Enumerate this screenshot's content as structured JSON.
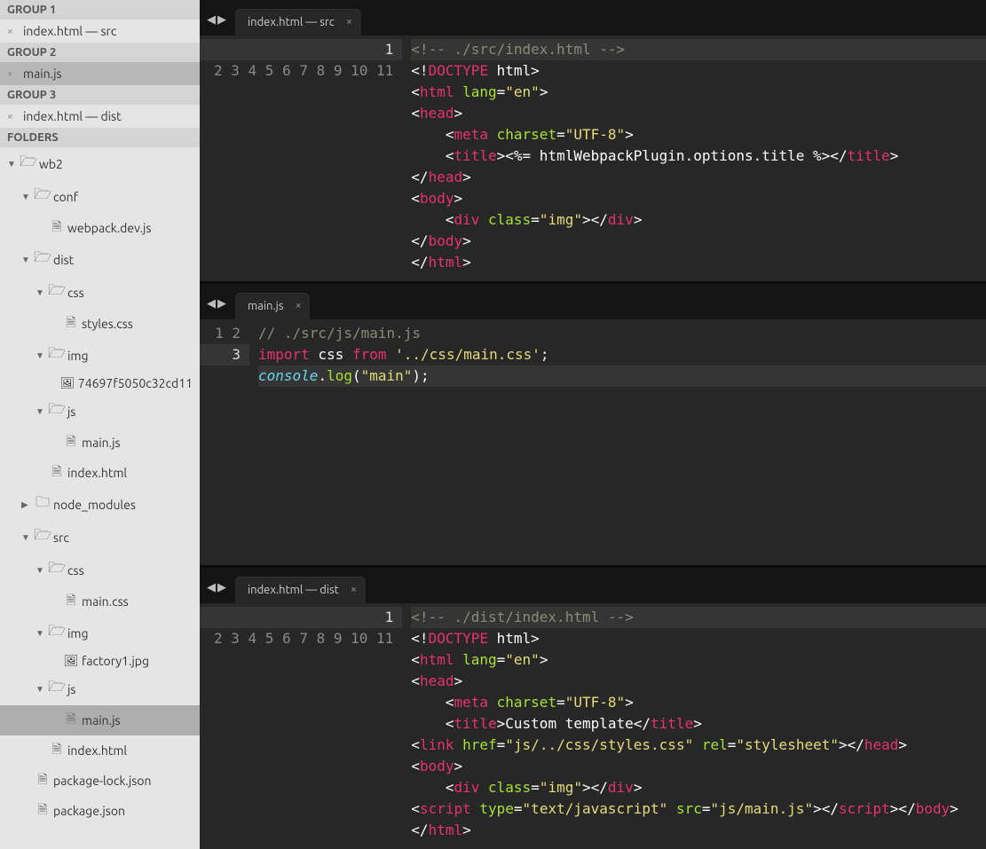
{
  "sidebar": {
    "groups": [
      {
        "title": "GROUP 1",
        "items": [
          {
            "label": "index.html — src",
            "active": false
          }
        ]
      },
      {
        "title": "GROUP 2",
        "items": [
          {
            "label": "main.js",
            "active": true
          }
        ]
      },
      {
        "title": "GROUP 3",
        "items": [
          {
            "label": "index.html — dist",
            "active": false
          }
        ]
      }
    ],
    "folders_label": "FOLDERS",
    "tree": [
      {
        "d": 0,
        "t": "folder-open",
        "a": "down",
        "l": "wb2"
      },
      {
        "d": 1,
        "t": "folder-open",
        "a": "down",
        "l": "conf"
      },
      {
        "d": 2,
        "t": "file",
        "l": "webpack.dev.js"
      },
      {
        "d": 1,
        "t": "folder-open",
        "a": "down",
        "l": "dist"
      },
      {
        "d": 2,
        "t": "folder-open",
        "a": "down",
        "l": "css"
      },
      {
        "d": 3,
        "t": "file",
        "l": "styles.css"
      },
      {
        "d": 2,
        "t": "folder-open",
        "a": "down",
        "l": "img"
      },
      {
        "d": 3,
        "t": "img",
        "l": "74697f5050c32cd11"
      },
      {
        "d": 2,
        "t": "folder-open",
        "a": "down",
        "l": "js"
      },
      {
        "d": 3,
        "t": "file",
        "l": "main.js"
      },
      {
        "d": 2,
        "t": "file",
        "l": "index.html"
      },
      {
        "d": 1,
        "t": "folder",
        "a": "right",
        "l": "node_modules"
      },
      {
        "d": 1,
        "t": "folder-open",
        "a": "down",
        "l": "src"
      },
      {
        "d": 2,
        "t": "folder-open",
        "a": "down",
        "l": "css"
      },
      {
        "d": 3,
        "t": "file",
        "l": "main.css"
      },
      {
        "d": 2,
        "t": "folder-open",
        "a": "down",
        "l": "img"
      },
      {
        "d": 3,
        "t": "img",
        "l": "factory1.jpg"
      },
      {
        "d": 2,
        "t": "folder-open",
        "a": "down",
        "l": "js"
      },
      {
        "d": 3,
        "t": "file",
        "l": "main.js",
        "sel": true
      },
      {
        "d": 2,
        "t": "file",
        "l": "index.html"
      },
      {
        "d": 1,
        "t": "file",
        "l": "package-lock.json"
      },
      {
        "d": 1,
        "t": "file",
        "l": "package.json"
      }
    ]
  },
  "panes": [
    {
      "tab": "index.html — src",
      "active_line": 1,
      "lines": [
        "<span class='cm'>&lt;!-- ./src/index.html --&gt;</span>",
        "<span class='pn'>&lt;!</span><span class='kw'>DOCTYPE</span><span class='pn'> html&gt;</span>",
        "<span class='pn'>&lt;</span><span class='kw'>html</span> <span class='tg'>lang</span><span class='pn'>=</span><span class='st'>\"en\"</span><span class='pn'>&gt;</span>",
        "<span class='pn'>&lt;</span><span class='kw'>head</span><span class='pn'>&gt;</span>",
        "    <span class='pn'>&lt;</span><span class='kw'>meta</span> <span class='tg'>charset</span><span class='pn'>=</span><span class='st'>\"UTF-8\"</span><span class='pn'>&gt;</span>",
        "    <span class='pn'>&lt;</span><span class='kw'>title</span><span class='pn'>&gt;&lt;%= htmlWebpackPlugin.options.title %&gt;&lt;/</span><span class='kw'>title</span><span class='pn'>&gt;</span>",
        "<span class='pn'>&lt;/</span><span class='kw'>head</span><span class='pn'>&gt;</span>",
        "<span class='pn'>&lt;</span><span class='kw'>body</span><span class='pn'>&gt;</span>",
        "    <span class='pn'>&lt;</span><span class='kw'>div</span> <span class='tg'>class</span><span class='pn'>=</span><span class='st'>\"img\"</span><span class='pn'>&gt;&lt;/</span><span class='kw'>div</span><span class='pn'>&gt;</span>",
        "<span class='pn'>&lt;/</span><span class='kw'>body</span><span class='pn'>&gt;</span>",
        "<span class='pn'>&lt;/</span><span class='kw'>html</span><span class='pn'>&gt;</span>"
      ]
    },
    {
      "tab": "main.js",
      "active_line": 3,
      "lines": [
        "<span class='cm'>// ./src/js/main.js</span>",
        "<span class='kw'>import</span> css <span class='kw'>from</span> <span class='st'>'../css/main.css'</span><span class='pn'>;</span>",
        "<span class='fn it'>console</span><span class='pn'>.</span><span class='tg'>log</span><span class='pn'>(</span><span class='st'>\"main\"</span><span class='pn'>);</span>"
      ]
    },
    {
      "tab": "index.html — dist",
      "active_line": 1,
      "lines": [
        "<span class='cm'>&lt;!-- ./dist/index.html --&gt;</span>",
        "<span class='pn'>&lt;!</span><span class='kw'>DOCTYPE</span><span class='pn'> html&gt;</span>",
        "<span class='pn'>&lt;</span><span class='kw'>html</span> <span class='tg'>lang</span><span class='pn'>=</span><span class='st'>\"en\"</span><span class='pn'>&gt;</span>",
        "<span class='pn'>&lt;</span><span class='kw'>head</span><span class='pn'>&gt;</span>",
        "    <span class='pn'>&lt;</span><span class='kw'>meta</span> <span class='tg'>charset</span><span class='pn'>=</span><span class='st'>\"UTF-8\"</span><span class='pn'>&gt;</span>",
        "    <span class='pn'>&lt;</span><span class='kw'>title</span><span class='pn'>&gt;Custom template&lt;/</span><span class='kw'>title</span><span class='pn'>&gt;</span>",
        "<span class='pn'>&lt;</span><span class='kw'>link</span> <span class='tg'>href</span><span class='pn'>=</span><span class='st'>\"js/../css/styles.css\"</span> <span class='tg'>rel</span><span class='pn'>=</span><span class='st'>\"stylesheet\"</span><span class='pn'>&gt;&lt;/</span><span class='kw'>head</span><span class='pn'>&gt;</span>",
        "<span class='pn'>&lt;</span><span class='kw'>body</span><span class='pn'>&gt;</span>",
        "    <span class='pn'>&lt;</span><span class='kw'>div</span> <span class='tg'>class</span><span class='pn'>=</span><span class='st'>\"img\"</span><span class='pn'>&gt;&lt;/</span><span class='kw'>div</span><span class='pn'>&gt;</span>",
        "<span class='pn'>&lt;</span><span class='kw'>script</span> <span class='tg'>type</span><span class='pn'>=</span><span class='st'>\"text/javascript\"</span> <span class='tg'>src</span><span class='pn'>=</span><span class='st'>\"js/main.js\"</span><span class='pn'>&gt;&lt;/</span><span class='kw'>script</span><span class='pn'>&gt;&lt;/</span><span class='kw'>body</span><span class='pn'>&gt;</span>",
        "<span class='pn'>&lt;/</span><span class='kw'>html</span><span class='pn'>&gt;</span>"
      ]
    }
  ]
}
